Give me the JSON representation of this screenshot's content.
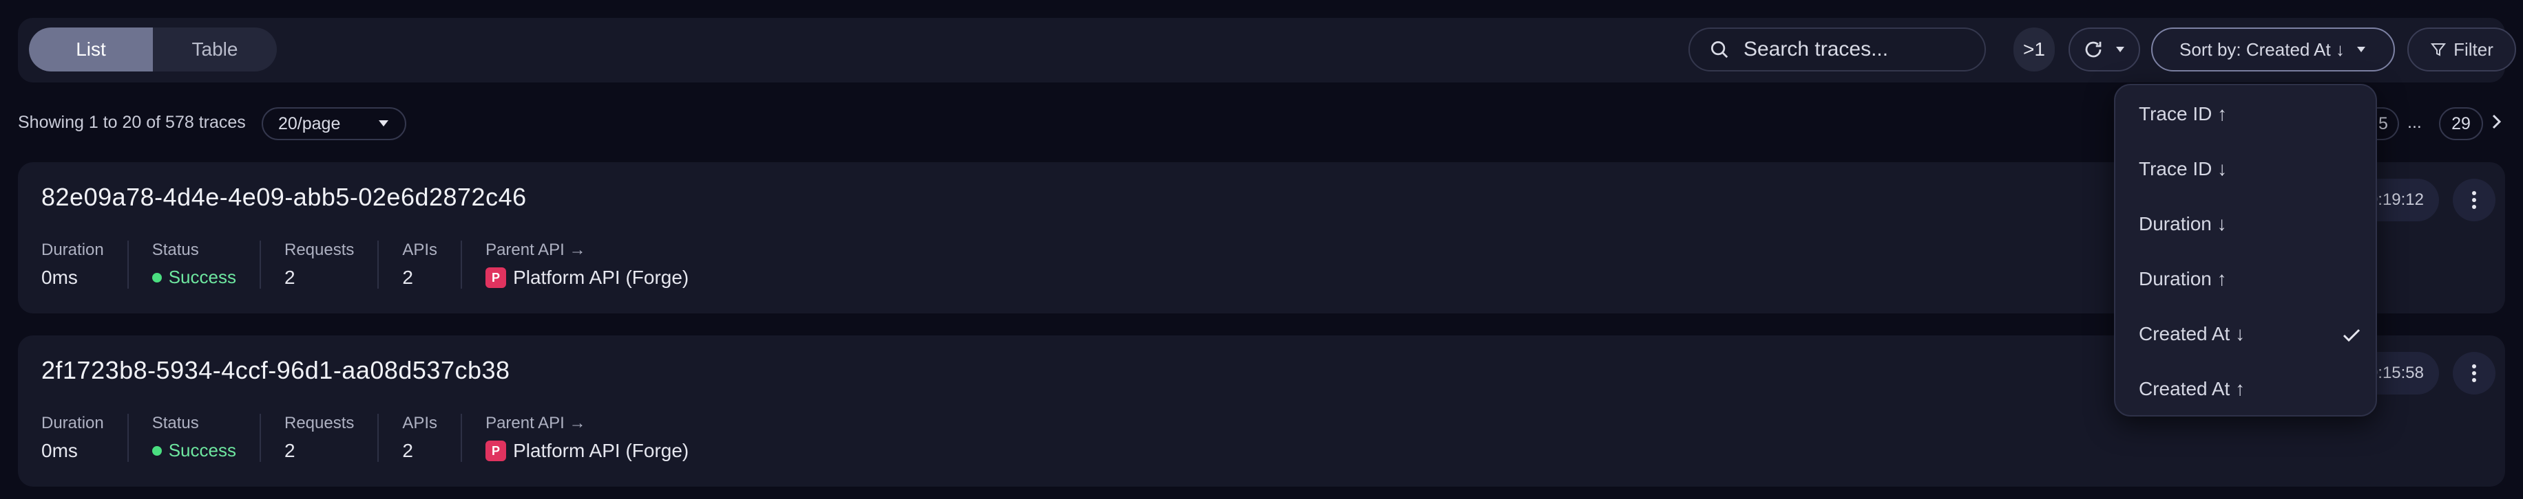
{
  "view_toggle": {
    "list": "List",
    "table": "Table"
  },
  "search": {
    "placeholder": "Search traces..."
  },
  "toolbar": {
    "gt_label": ">1",
    "sort_label": "Sort by: Created At ↓",
    "filter_label": "Filter"
  },
  "summary": {
    "showing": "Showing 1 to 20 of 578 traces",
    "per_page": "20/page"
  },
  "pagination": {
    "partial_page": "5",
    "ellipsis": "...",
    "last_page": "29"
  },
  "traces": [
    {
      "id": "82e09a78-4d4e-4e09-abb5-02e6d2872c46",
      "time": "0:19:12",
      "duration_label": "Duration",
      "duration": "0ms",
      "status_label": "Status",
      "status": "Success",
      "requests_label": "Requests",
      "requests": "2",
      "apis_label": "APIs",
      "apis": "2",
      "parent_label": "Parent API →",
      "parent_badge": "P",
      "parent": "Platform API (Forge)"
    },
    {
      "id": "2f1723b8-5934-4ccf-96d1-aa08d537cb38",
      "time": "0:15:58",
      "duration_label": "Duration",
      "duration": "0ms",
      "status_label": "Status",
      "status": "Success",
      "requests_label": "Requests",
      "requests": "2",
      "apis_label": "APIs",
      "apis": "2",
      "parent_label": "Parent API →",
      "parent_badge": "P",
      "parent": "Platform API (Forge)"
    }
  ],
  "sort_menu": {
    "items": [
      "Trace ID ↑",
      "Trace ID ↓",
      "Duration ↓",
      "Duration ↑",
      "Created At ↓",
      "Created At ↑"
    ],
    "selected": "Created At ↓"
  },
  "colors": {
    "background": "#0b0c19",
    "card": "#161828",
    "success": "#4ade80",
    "badge": "#e0335f",
    "active_toggle": "#6e7390"
  }
}
